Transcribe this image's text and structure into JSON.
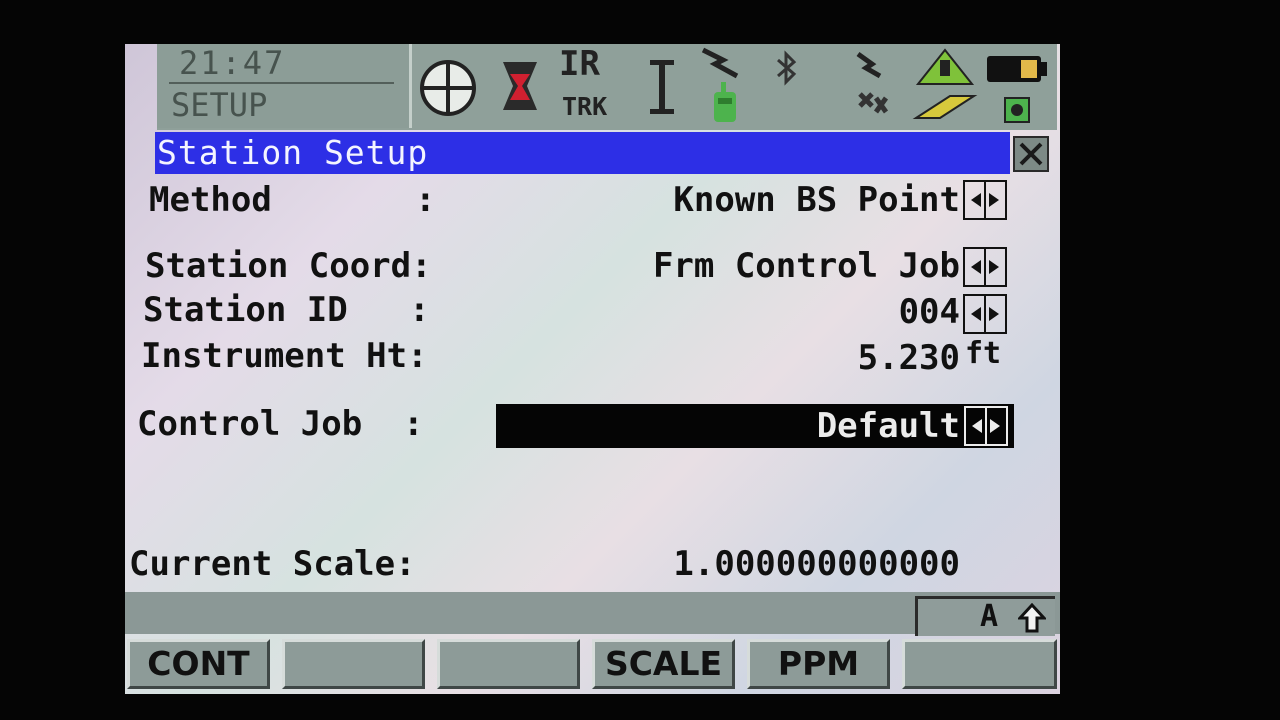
{
  "status": {
    "time": "21:47",
    "mode": "SETUP",
    "ir": "IR",
    "trk": "TRK"
  },
  "window": {
    "title": "Station Setup"
  },
  "fields": {
    "method": {
      "label": "Method       :",
      "value": "Known BS Point"
    },
    "station_coord": {
      "label": "Station Coord:",
      "value": "Frm Control Job"
    },
    "station_id": {
      "label": "Station ID   :",
      "value": "004"
    },
    "instrument_ht": {
      "label": "Instrument Ht:",
      "value": "5.230",
      "unit": "ft"
    },
    "control_job": {
      "label": "Control Job  :",
      "value": "Default"
    },
    "current_scale": {
      "label": "Current Scale:",
      "value": "1.000000000000"
    }
  },
  "input_mode": "A",
  "softkeys": [
    "CONT",
    "",
    "",
    "SCALE",
    "PPM",
    ""
  ],
  "colors": {
    "title_bar": "#2d2fe6",
    "status_bar": "#8fa09a",
    "selected_field": "#050505"
  }
}
